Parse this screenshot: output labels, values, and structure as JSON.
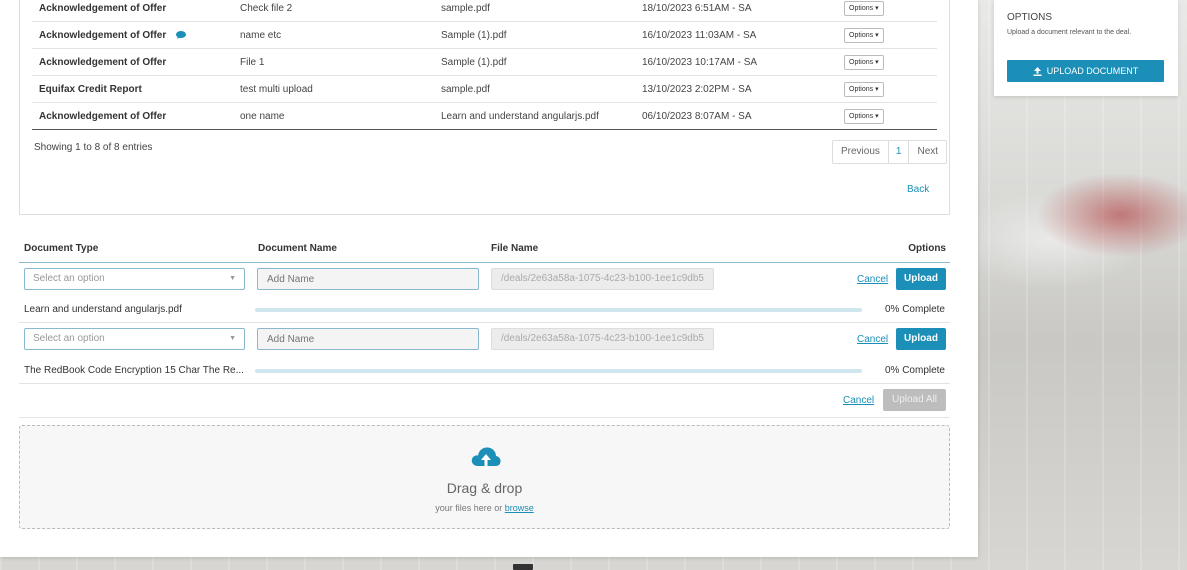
{
  "documents": [
    {
      "type": "Acknowledgement of Offer",
      "name": "Check file 2",
      "file": "sample.pdf",
      "date": "18/10/2023 6:51AM - SA",
      "has_comment": false
    },
    {
      "type": "Acknowledgement of Offer",
      "name": "name etc",
      "file": "Sample (1).pdf",
      "date": "16/10/2023 11:03AM - SA",
      "has_comment": true
    },
    {
      "type": "Acknowledgement of Offer",
      "name": "File 1",
      "file": "Sample (1).pdf",
      "date": "16/10/2023 10:17AM - SA",
      "has_comment": false
    },
    {
      "type": "Equifax Credit Report",
      "name": "test multi upload",
      "file": "sample.pdf",
      "date": "13/10/2023 2:02PM - SA",
      "has_comment": false
    },
    {
      "type": "Acknowledgement of Offer",
      "name": "one name",
      "file": "Learn and understand angularjs.pdf",
      "date": "06/10/2023 8:07AM - SA",
      "has_comment": false
    }
  ],
  "options_label": "Options",
  "showing_text": "Showing 1 to 8 of 8 entries",
  "pagination": {
    "previous": "Previous",
    "current": "1",
    "next": "Next"
  },
  "back_label": "Back",
  "upload_table": {
    "headers": {
      "type": "Document Type",
      "name": "Document Name",
      "file": "File Name",
      "options": "Options"
    },
    "rows": [
      {
        "select_placeholder": "Select an option",
        "name_placeholder": "Add Name",
        "path": "/deals/2e63a58a-1075-4c23-b100-1ee1c9db5",
        "cancel": "Cancel",
        "upload": "Upload",
        "filename": "Learn and understand angularjs.pdf",
        "progress": 0,
        "progress_text": "0% Complete"
      },
      {
        "select_placeholder": "Select an option",
        "name_placeholder": "Add Name",
        "path": "/deals/2e63a58a-1075-4c23-b100-1ee1c9db5",
        "cancel": "Cancel",
        "upload": "Upload",
        "filename": "The RedBook Code Encryption 15 Char The Re...",
        "progress": 0,
        "progress_text": "0% Complete"
      }
    ],
    "cancel_all": "Cancel",
    "upload_all": "Upload All"
  },
  "dropzone": {
    "title": "Drag & drop",
    "sub_prefix": "your files here or",
    "browse": "browse"
  },
  "side": {
    "title": "OPTIONS",
    "desc": "Upload a document relevant to the deal.",
    "button": "UPLOAD DOCUMENT"
  },
  "colors": {
    "accent": "#1b8fb8",
    "disabled": "#bdbdbd"
  }
}
